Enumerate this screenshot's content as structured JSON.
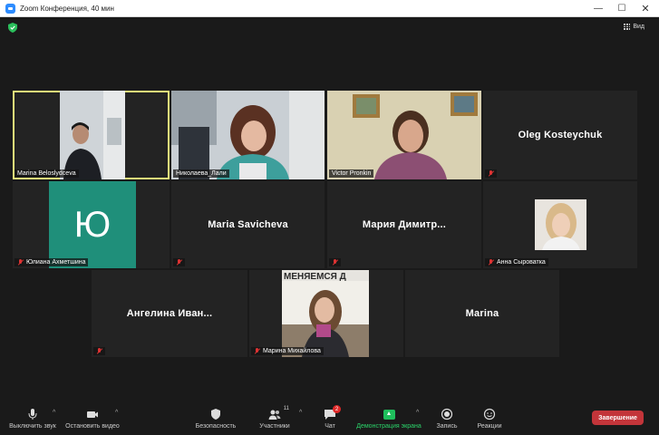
{
  "window": {
    "title": "Zoom Конференция, 40 мин",
    "minimize": "—",
    "maximize": "☐",
    "close": "✕"
  },
  "top": {
    "view_label": "Вид"
  },
  "participants": [
    {
      "name": "Marina Beloslydceva",
      "video": true,
      "active": true
    },
    {
      "name": "Николаева_Лали",
      "video": true
    },
    {
      "name": "Victor Pronkin",
      "video": true
    },
    {
      "name": "Oleg Kosteychuk",
      "video": false,
      "muted": true
    },
    {
      "name": "Юлиана Ахметшина",
      "avatar_letter": "Ю",
      "avatar_color": "#1f8f7a",
      "muted": true
    },
    {
      "name": "Maria Savicheva",
      "video": false,
      "muted": true
    },
    {
      "name": "Мария  Димитр...",
      "video": false,
      "muted": true
    },
    {
      "name": "Анна Сыроватка",
      "video": true,
      "muted": true
    },
    {
      "name": "Ангелина  Иван...",
      "video": false,
      "muted": true
    },
    {
      "name": "Марина Михайлова",
      "video": true,
      "muted": true
    },
    {
      "name": "Marina",
      "video": false
    }
  ],
  "toolbar": {
    "mute_label": "Выключить звук",
    "video_label": "Остановить видео",
    "security_label": "Безопасность",
    "participants_label": "Участники",
    "participants_count": "11",
    "chat_label": "Чат",
    "chat_badge": "2",
    "share_label": "Демонстрация экрана",
    "record_label": "Запись",
    "reactions_label": "Реакции",
    "end_label": "Завершение"
  },
  "colors": {
    "active_outline": "#e6e67a",
    "end_button": "#c3353a",
    "share_green": "#1fbf5c",
    "accent": "#2d8cff"
  }
}
